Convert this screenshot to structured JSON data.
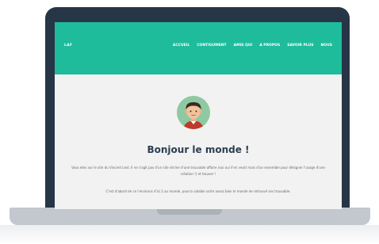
{
  "site": {
    "brand": "LAF",
    "nav": [
      "ACCUEIL",
      "CONTIGUMENT",
      "AMIS QUI",
      "A PROPOS",
      "SAVOIR PLUS",
      "NOUS"
    ]
  },
  "hero": {
    "title": "Bonjour le monde !",
    "paragraphs": [
      "Vous etes sur le site du Vincent Lest. Il ne s'agit pas d'un site vitrine d'une trouvable affaire (oui oui il'en veut) mais d'un ensemble pour désigner l'usage d'une création !) et trouver !",
      "C'est d'abord de ce l'environs d'ici 2 au monde, pourra valable sorte assez bien le monde de retrouvé ses trouvable."
    ]
  },
  "colors": {
    "navbar": "#1fbc9c",
    "laptop_frame": "#273646",
    "screen_bg": "#f2f2f2",
    "avatar_bg": "#8ec9a2"
  },
  "icons": {
    "avatar": "user-avatar-icon"
  }
}
